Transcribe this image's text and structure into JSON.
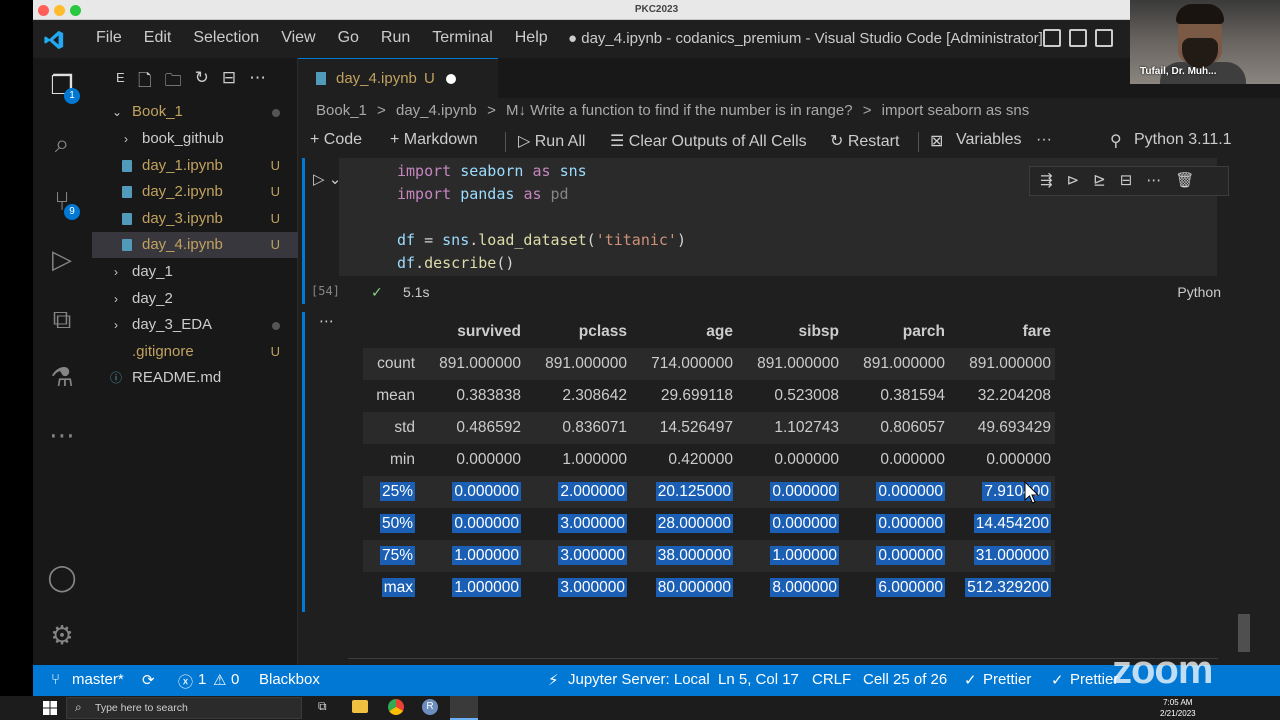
{
  "mac": {
    "title": "PKC2023",
    "colors": {
      "close": "#ff5f57",
      "min": "#febc2e",
      "max": "#28c840"
    }
  },
  "titlebar": {
    "menu": [
      "File",
      "Edit",
      "Selection",
      "View",
      "Go",
      "Run",
      "Terminal",
      "Help"
    ],
    "window_title": "● day_4.ipynb - codanics_premium - Visual Studio Code [Administrator]"
  },
  "activity": {
    "explorer_badge": "1",
    "scm_badge": "9",
    "icons": [
      "explorer-icon",
      "search-icon",
      "source-control-icon",
      "run-debug-icon",
      "extensions-icon",
      "testing-icon",
      "more-icon",
      "account-icon",
      "settings-gear-icon"
    ]
  },
  "sidebar": {
    "header_label": "E",
    "items": [
      {
        "label": "Book_1",
        "type": "folder-open",
        "indent": 0
      },
      {
        "label": "book_github",
        "type": "folder",
        "indent": 1
      },
      {
        "label": "day_1.ipynb",
        "type": "file",
        "indent": 1,
        "badge": "U"
      },
      {
        "label": "day_2.ipynb",
        "type": "file",
        "indent": 1,
        "badge": "U"
      },
      {
        "label": "day_3.ipynb",
        "type": "file",
        "indent": 1,
        "badge": "U"
      },
      {
        "label": "day_4.ipynb",
        "type": "file",
        "indent": 1,
        "badge": "U"
      },
      {
        "label": "day_1",
        "type": "folder",
        "indent": 0
      },
      {
        "label": "day_2",
        "type": "folder",
        "indent": 0
      },
      {
        "label": "day_3_EDA",
        "type": "folder",
        "indent": 0
      },
      {
        "label": ".gitignore",
        "type": "file",
        "indent": 0,
        "badge": "U"
      },
      {
        "label": "README.md",
        "type": "info",
        "indent": 0
      }
    ]
  },
  "editor": {
    "tab": {
      "label": "day_4.ipynb",
      "status": "U"
    },
    "breadcrumb": [
      "Book_1",
      ">",
      "day_4.ipynb",
      ">",
      "M↓ Write a function to find if the number is in range?",
      ">",
      "import seaborn as sns"
    ],
    "toolbar": {
      "code": "+ Code",
      "markdown": "+ Markdown",
      "run_all": "▷ Run All",
      "clear": "☰ Clear Outputs of All Cells",
      "restart": "↻ Restart",
      "variables": "Variables",
      "more": "···",
      "kernel": "Python 3.11.1"
    },
    "cell": {
      "exec_count": "[54]",
      "check": "✓",
      "time": "5.1s",
      "language": "Python"
    }
  },
  "output_table": {
    "columns": [
      "",
      "survived",
      "pclass",
      "age",
      "sibsp",
      "parch",
      "fare"
    ],
    "rows": [
      [
        "count",
        "891.000000",
        "891.000000",
        "714.000000",
        "891.000000",
        "891.000000",
        "891.000000"
      ],
      [
        "mean",
        "0.383838",
        "2.308642",
        "29.699118",
        "0.523008",
        "0.381594",
        "32.204208"
      ],
      [
        "std",
        "0.486592",
        "0.836071",
        "14.526497",
        "1.102743",
        "0.806057",
        "49.693429"
      ],
      [
        "min",
        "0.000000",
        "1.000000",
        "0.420000",
        "0.000000",
        "0.000000",
        "0.000000"
      ],
      [
        "25%",
        "0.000000",
        "2.000000",
        "20.125000",
        "0.000000",
        "0.000000",
        "7.910400"
      ],
      [
        "50%",
        "0.000000",
        "3.000000",
        "28.000000",
        "0.000000",
        "0.000000",
        "14.454200"
      ],
      [
        "75%",
        "1.000000",
        "3.000000",
        "38.000000",
        "1.000000",
        "0.000000",
        "31.000000"
      ],
      [
        "max",
        "1.000000",
        "3.000000",
        "80.000000",
        "8.000000",
        "6.000000",
        "512.329200"
      ]
    ],
    "highlighted_from_row": 4
  },
  "statusbar": {
    "branch": "master*",
    "errors": "1",
    "warnings": "0",
    "blackbox": "Blackbox",
    "jupyter": "Jupyter Server: Local",
    "position": "Ln 5, Col 17",
    "eol": "CRLF",
    "cell": "Cell 25 of 26",
    "prettier1": "Prettier",
    "prettier2": "Prettier"
  },
  "taskbar": {
    "search_placeholder": "Type here to search",
    "time": "7:05 AM",
    "date": "2/21/2023"
  },
  "webcam": {
    "name": "Tufail, Dr. Muh..."
  },
  "watermark": "zoom"
}
